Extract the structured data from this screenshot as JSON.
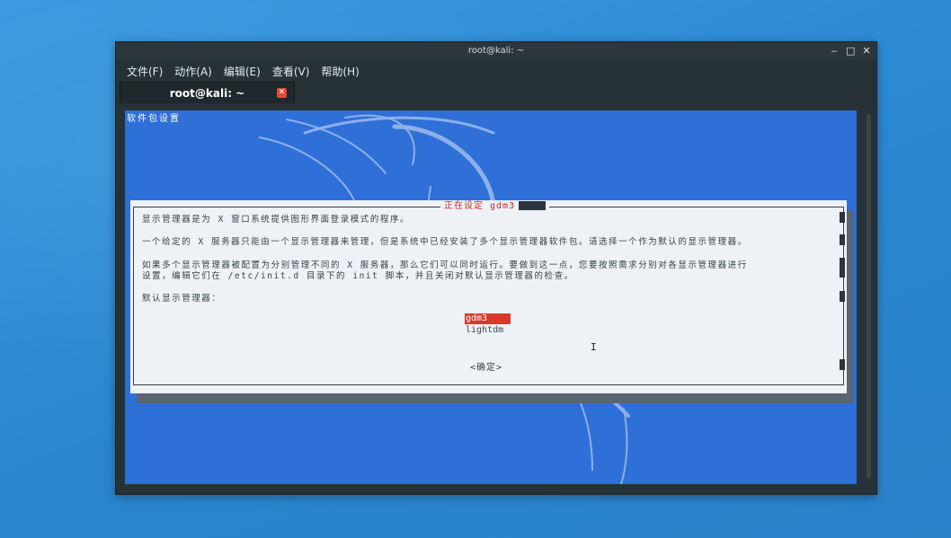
{
  "window": {
    "title": "root@kali: ~",
    "controls": {
      "minimize": "‒",
      "maximize": "□",
      "close": "✕"
    }
  },
  "menubar": {
    "items": [
      {
        "label": "文件(F)"
      },
      {
        "label": "动作(A)"
      },
      {
        "label": "编辑(E)"
      },
      {
        "label": "查看(V)"
      },
      {
        "label": "帮助(H)"
      }
    ]
  },
  "tabs": [
    {
      "label": "root@kali: ~",
      "close_icon": "close-icon",
      "close_glyph": "✕"
    }
  ],
  "terminal": {
    "header": "软件包设置",
    "background_color": "#2f6fd8"
  },
  "dialog": {
    "title": "正在设定 gdm3",
    "paragraph1": "显示管理器是为 X 窗口系统提供图形界面登录模式的程序。",
    "paragraph2": "一个给定的 X 服务器只能由一个显示管理器来管理，但是系统中已经安装了多个显示管理器软件包。请选择一个作为默认的显示管理器。",
    "paragraph3_line1": "如果多个显示管理器被配置为分别管理不同的 X 服务器，那么它们可以同时运行。要做到这一点，您要按照需求分别对各显示管理器进行",
    "paragraph3_line2": "设置，编辑它们在 /etc/init.d 目录下的 init 脚本，并且关闭对默认显示管理器的检查。",
    "prompt": "默认显示管理器：",
    "options": [
      {
        "label": "gdm3",
        "selected": true
      },
      {
        "label": "lightdm",
        "selected": false
      }
    ],
    "ok_button": "<确定>",
    "accent_color": "#d9382a"
  },
  "mouse_cursor": {
    "glyph": "I",
    "icon": "text-cursor-icon"
  }
}
